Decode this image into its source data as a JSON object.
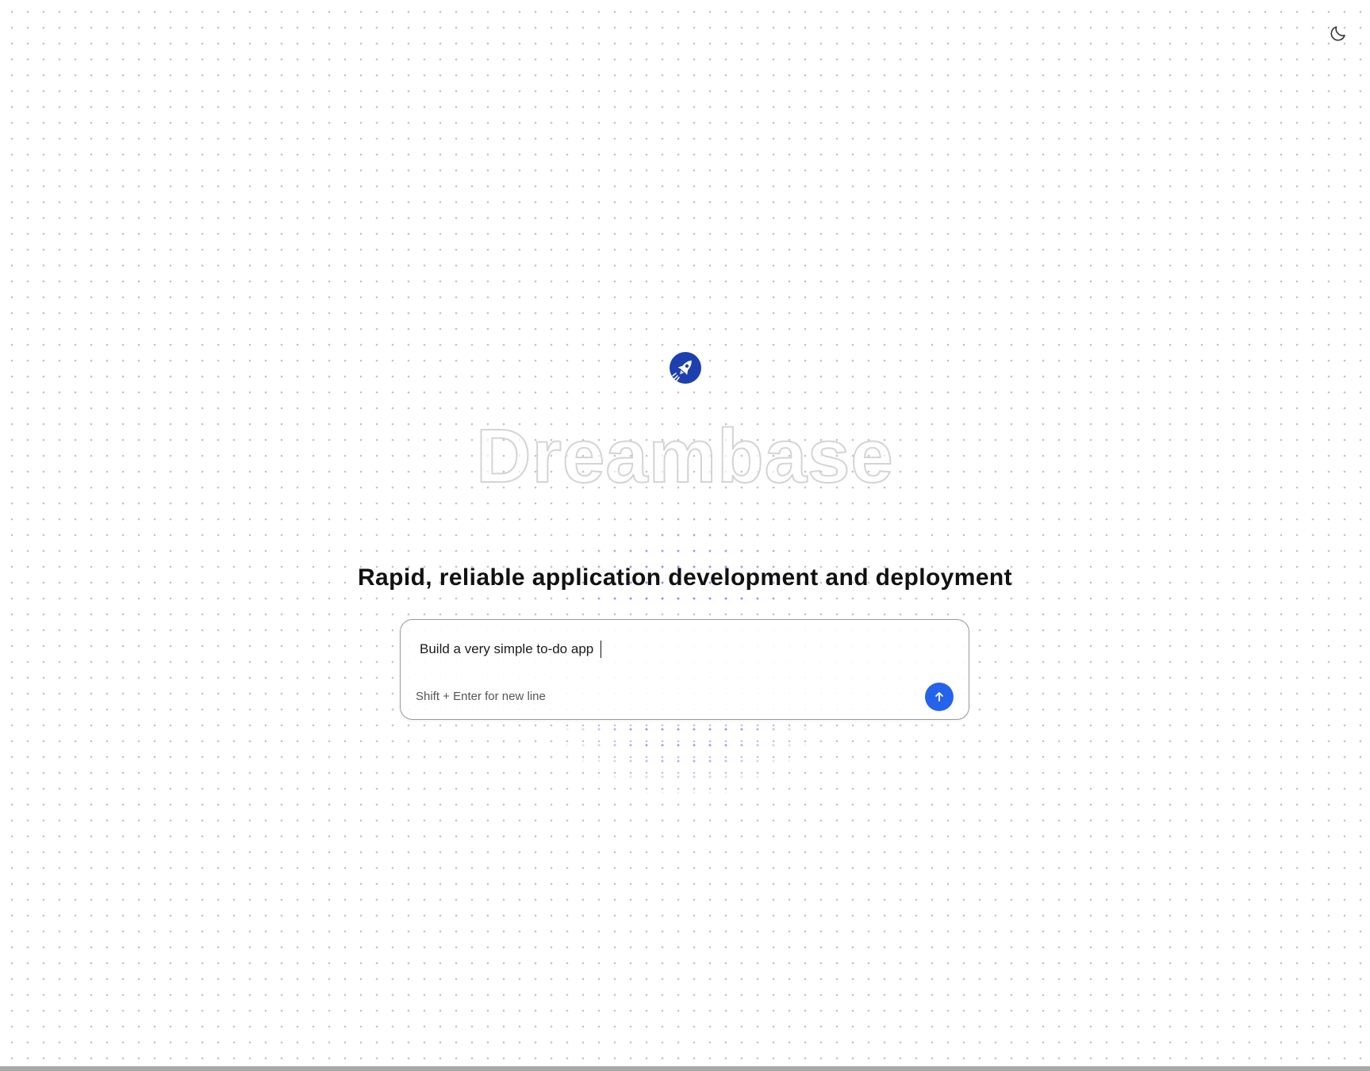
{
  "header": {
    "theme_toggle_icon": "moon-icon"
  },
  "hero": {
    "logo_icon": "rocket-icon",
    "brand_name": "Dreambase",
    "tagline": "Rapid, reliable application development and deployment"
  },
  "prompt": {
    "value": "Build a very simple to-do app",
    "hint": "Shift + Enter for new line",
    "send_icon": "arrow-up-icon"
  },
  "colors": {
    "accent": "#2563eb",
    "logo_bg": "#1e40af",
    "dot_grid": "#c4c4c4",
    "dot_highlight": "#8a8ff0"
  }
}
